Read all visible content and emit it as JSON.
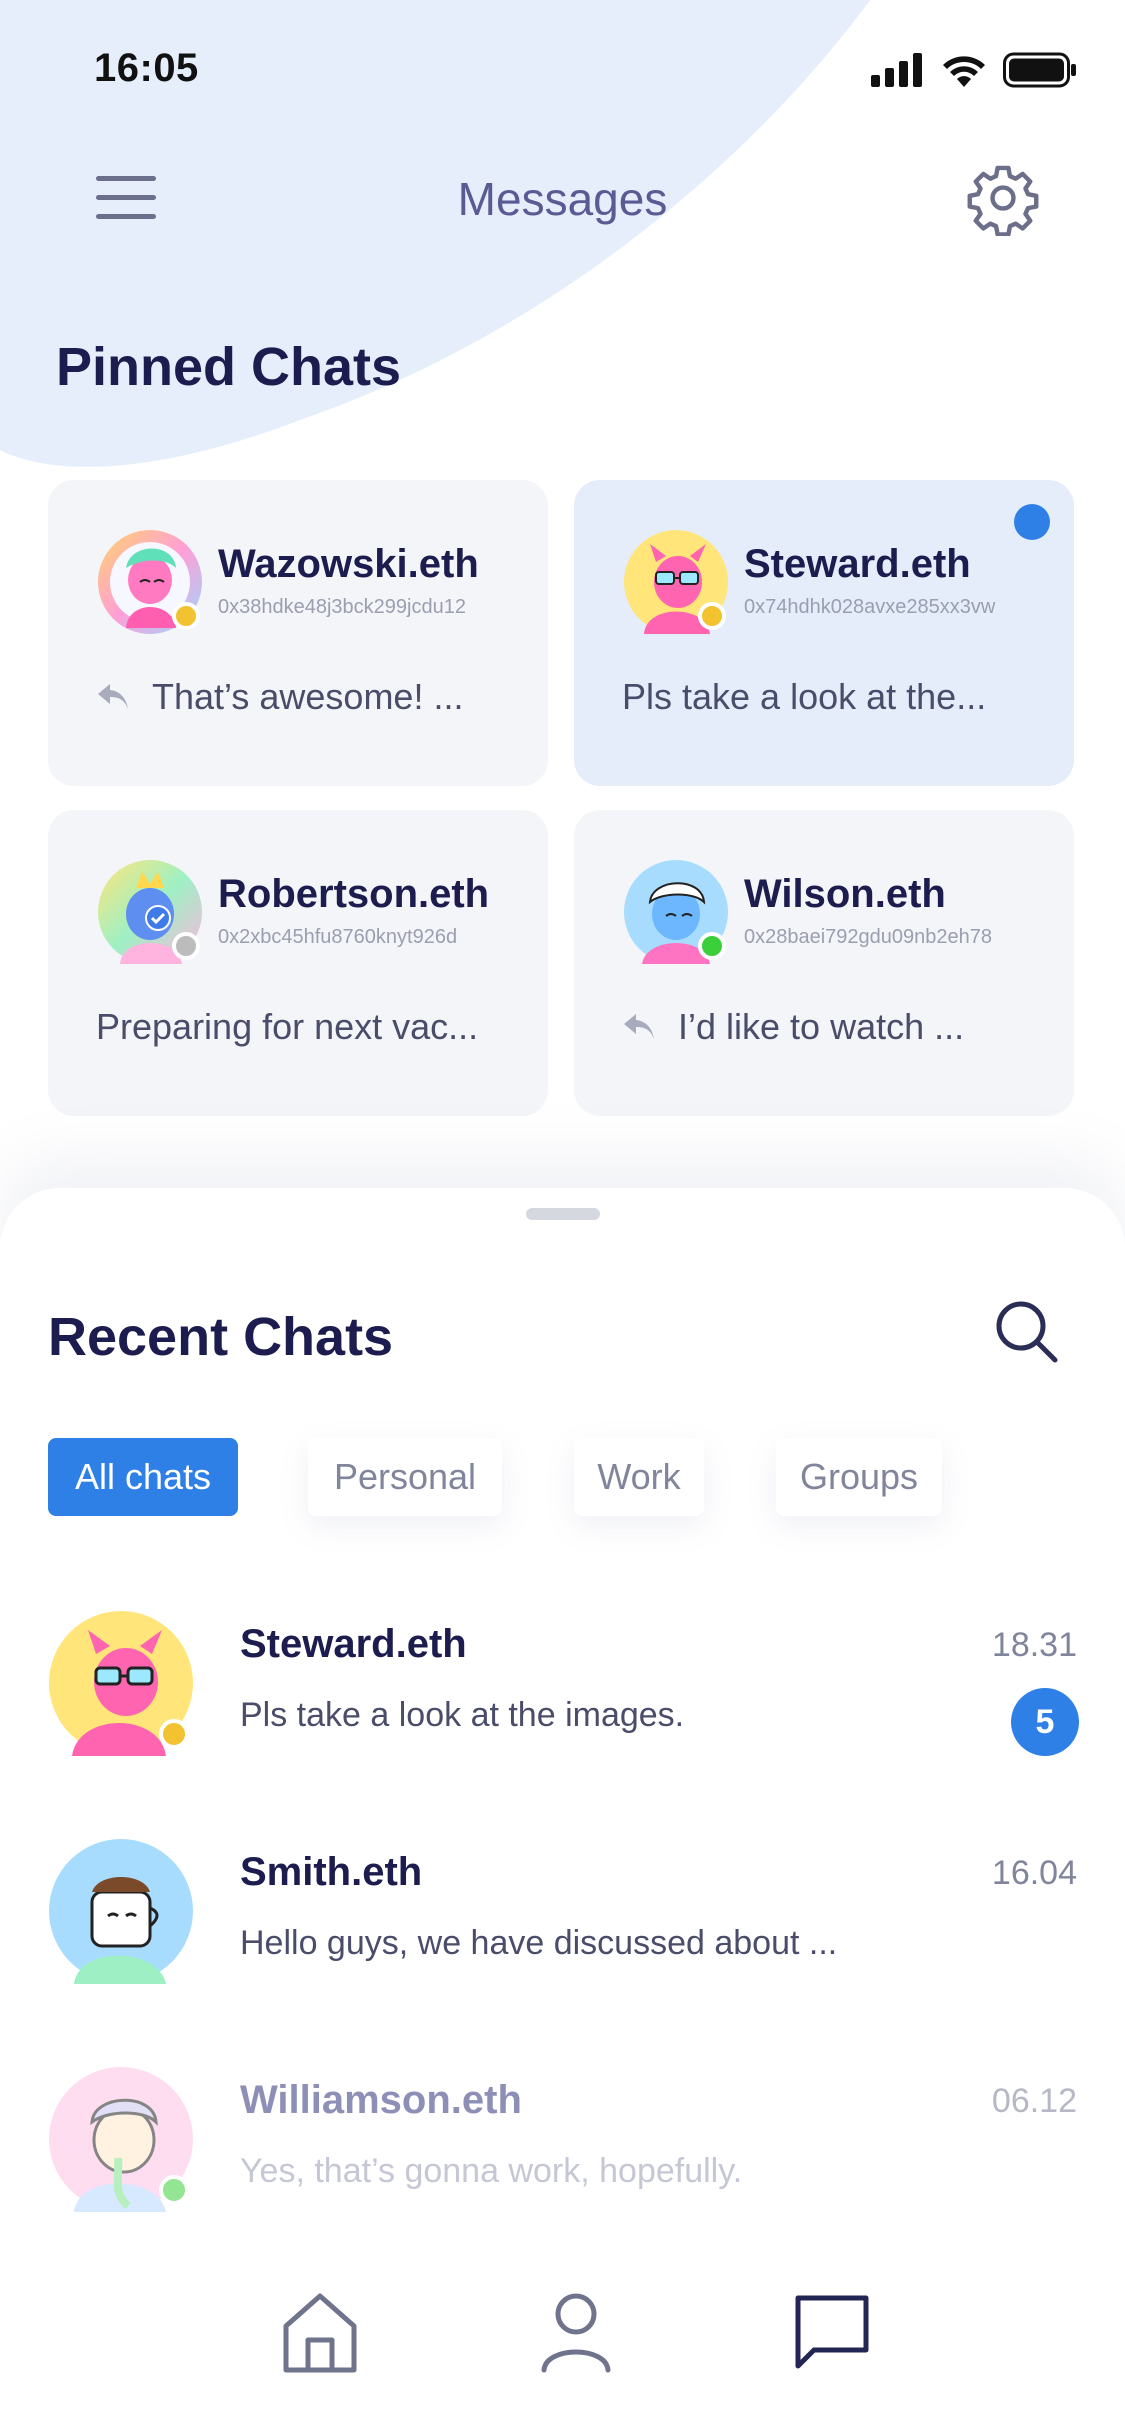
{
  "status_bar": {
    "time": "16:05"
  },
  "header": {
    "title": "Messages",
    "menu_icon": "hamburger-icon",
    "settings_icon": "gear-icon"
  },
  "pinned": {
    "title": "Pinned Chats",
    "chats": [
      {
        "name": "Wazowski.eth",
        "address": "0x38hdke48j3bck299jcdu12",
        "preview": "That’s awesome! ...",
        "replied": true,
        "unread": false,
        "status_color": "#f2c230"
      },
      {
        "name": "Steward.eth",
        "address": "0x74hdhk028avxe285xx3vw",
        "preview": "Pls take a look at the...",
        "replied": false,
        "unread": true,
        "status_color": "#f2c230"
      },
      {
        "name": "Robertson.eth",
        "address": "0x2xbc45hfu8760knyt926d",
        "preview": "Preparing for next vac...",
        "replied": false,
        "unread": false,
        "status_color": "#bcbcbc"
      },
      {
        "name": "Wilson.eth",
        "address": "0x28baei792gdu09nb2eh78",
        "preview": "I’d like to watch ...",
        "replied": true,
        "unread": false,
        "status_color": "#3ccf3c"
      }
    ]
  },
  "recent": {
    "title": "Recent Chats",
    "tabs": [
      {
        "label": "All chats",
        "selected": true
      },
      {
        "label": "Personal",
        "selected": false
      },
      {
        "label": "Work",
        "selected": false
      },
      {
        "label": "Groups",
        "selected": false
      }
    ],
    "chats": [
      {
        "name": "Steward.eth",
        "message": "Pls take a look at the images.",
        "time": "18.31",
        "unread_count": "5",
        "status_color": "#f2c230"
      },
      {
        "name": "Smith.eth",
        "message": "Hello guys, we have discussed about ...",
        "time": "16.04",
        "unread_count": "",
        "status_color": ""
      },
      {
        "name": "Williamson.eth",
        "message": "Yes, that’s gonna work, hopefully.",
        "time": "06.12",
        "unread_count": "",
        "status_color": "#3ccf3c"
      }
    ]
  },
  "bottom_nav": {
    "items": [
      {
        "icon": "home-icon",
        "active": false
      },
      {
        "icon": "profile-icon",
        "active": false
      },
      {
        "icon": "chat-icon",
        "active": true
      }
    ]
  },
  "colors": {
    "accent": "#2f80e6",
    "title": "#1c1c4e",
    "header_bg": "#e6edfb"
  }
}
